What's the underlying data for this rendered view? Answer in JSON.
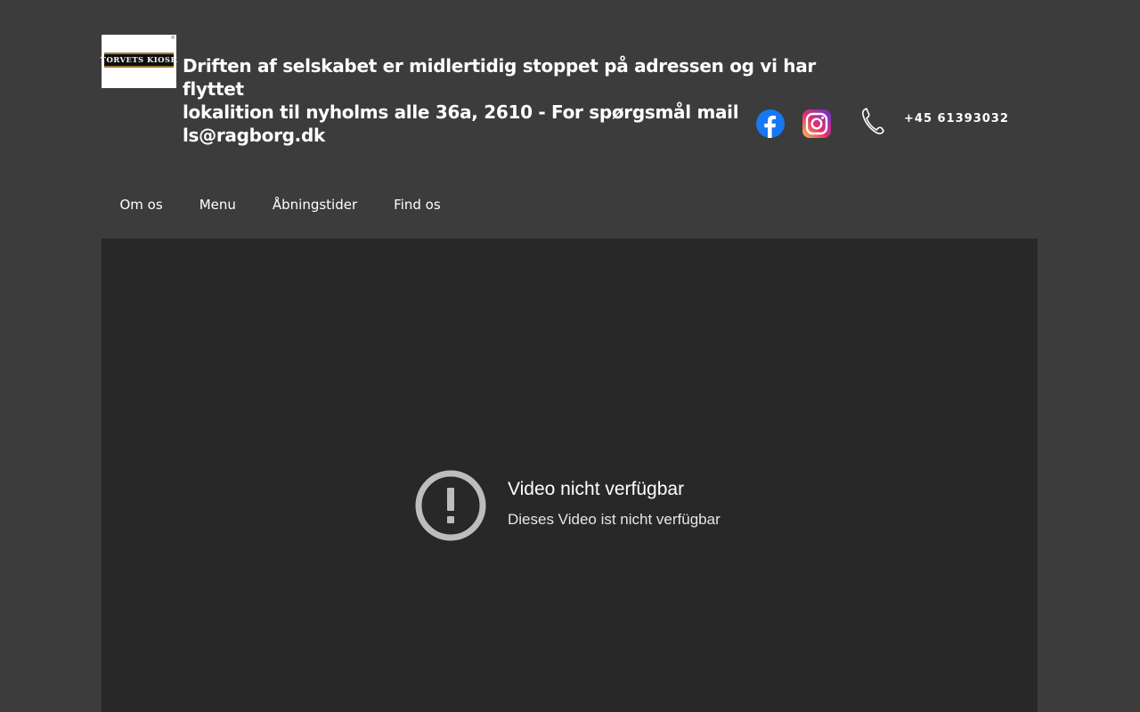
{
  "header": {
    "logo_text": "TORVETS KIOSK",
    "headline_line1": "Driften af selskabet er midlertidig stoppet på adressen og vi har flyttet",
    "headline_line2": "lokalition til nyholms alle 36a, 2610 - For spørgsmål mail ls@ragborg.dk",
    "social": [
      {
        "name": "facebook",
        "icon": "facebook-icon",
        "color": "#1877f2"
      },
      {
        "name": "instagram",
        "icon": "instagram-icon",
        "color": "#c13584"
      }
    ],
    "phone_icon": "phone-icon",
    "phone": "+45 61393032"
  },
  "nav": {
    "items": [
      {
        "label": "Om os"
      },
      {
        "label": "Menu"
      },
      {
        "label": "Åbningstider"
      },
      {
        "label": "Find os"
      }
    ]
  },
  "video": {
    "icon": "error-icon",
    "title": "Video nicht verfügbar",
    "subtitle": "Dieses Video ist nicht verfügbar"
  },
  "colors": {
    "page_background": "#3c3c3c",
    "video_background": "#282828",
    "text": "#ffffff",
    "error_icon": "#bdbdbd"
  }
}
